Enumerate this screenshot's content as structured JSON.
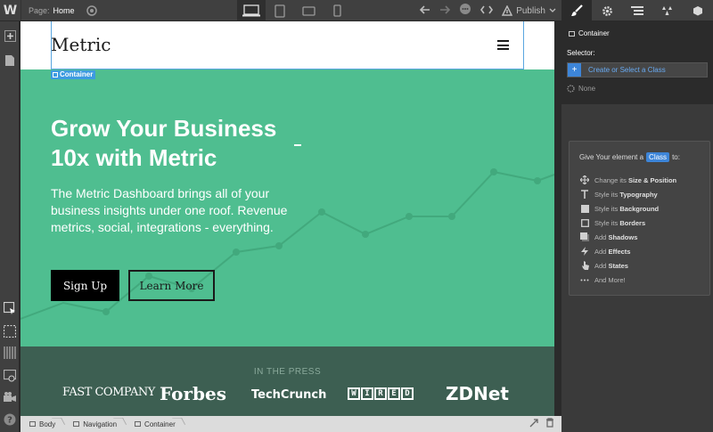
{
  "topbar": {
    "logo": "W",
    "page_label": "Page:",
    "page_name": "Home",
    "publish_label": "Publish"
  },
  "canvas": {
    "brand": "Metric",
    "selection_tag": "Container",
    "headline_line1": "Grow Your Business",
    "headline_line2": "10x with Metric",
    "subtext": "The Metric Dashboard brings all of your business insights under one roof. Revenue metrics, social, integrations - everything.",
    "primary_button": "Sign Up",
    "secondary_button": "Learn More",
    "accent_color": "#4fbe90",
    "press": {
      "title": "IN THE PRESS",
      "logos": [
        "FAST COMPANY",
        "Forbes",
        "TechCrunch",
        "WIRED",
        "ZDNet"
      ]
    }
  },
  "breadcrumbs": [
    "Body",
    "Navigation",
    "Container"
  ],
  "right_panel": {
    "element_title": "Container",
    "selector_label": "Selector:",
    "input_placeholder": "Create or Select a Class",
    "none_label": "None",
    "card": {
      "title_prefix": "Give Your element a",
      "title_badge": "Class",
      "title_suffix": "to:",
      "items": [
        {
          "icon": "move-icon",
          "prefix": "Change its",
          "bold": "Size & Position"
        },
        {
          "icon": "typography-icon",
          "prefix": "Style its",
          "bold": "Typography"
        },
        {
          "icon": "background-icon",
          "prefix": "Style its",
          "bold": "Background"
        },
        {
          "icon": "border-icon",
          "prefix": "Style its",
          "bold": "Borders"
        },
        {
          "icon": "shadow-icon",
          "prefix": "Add",
          "bold": "Shadows"
        },
        {
          "icon": "effects-icon",
          "prefix": "Add",
          "bold": "Effects"
        },
        {
          "icon": "states-icon",
          "prefix": "Add",
          "bold": "States"
        },
        {
          "icon": "more-icon",
          "prefix": "",
          "bold": "And More!"
        }
      ]
    }
  }
}
